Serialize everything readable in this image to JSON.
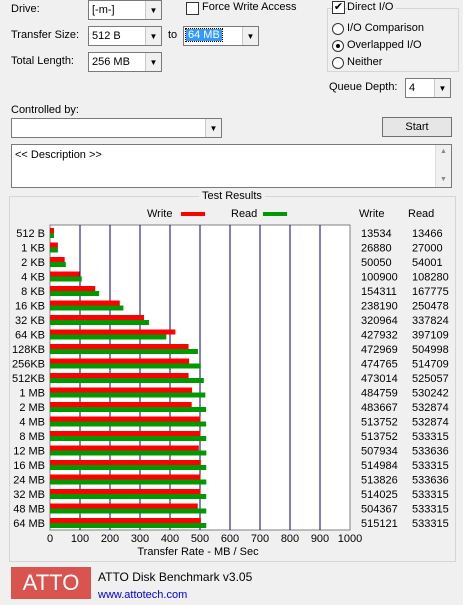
{
  "drive": {
    "label": "Drive:",
    "value": "[-m-]"
  },
  "force_write": {
    "label": "Force Write Access",
    "checked": false
  },
  "direct_io": {
    "label": "Direct I/O",
    "checked": true
  },
  "transfer_size": {
    "label": "Transfer Size:",
    "from": "512 B",
    "to_label": "to",
    "to": "64 MB"
  },
  "total_length": {
    "label": "Total Length:",
    "value": "256 MB"
  },
  "io_mode": {
    "options": [
      "I/O Comparison",
      "Overlapped I/O",
      "Neither"
    ],
    "selected": "Overlapped I/O"
  },
  "queue_depth": {
    "label": "Queue Depth:",
    "value": "4"
  },
  "controlled_by": {
    "label": "Controlled by:",
    "value": ""
  },
  "start_button": "Start",
  "description": "<< Description >>",
  "results": {
    "title": "Test Results",
    "legend_write": "Write",
    "legend_read": "Read",
    "col_write": "Write",
    "col_read": "Read",
    "write_color": "#ff0000",
    "read_color": "#009900",
    "grid_color": "#00008b"
  },
  "chart_data": {
    "type": "bar",
    "orientation": "horizontal",
    "categories": [
      "512 B",
      "1 KB",
      "2 KB",
      "4 KB",
      "8 KB",
      "16 KB",
      "32 KB",
      "64 KB",
      "128KB",
      "256KB",
      "512KB",
      "1 MB",
      "2 MB",
      "4 MB",
      "8 MB",
      "12 MB",
      "16 MB",
      "24 MB",
      "32 MB",
      "48 MB",
      "64 MB"
    ],
    "series": [
      {
        "name": "Write",
        "values": [
          13534,
          26880,
          50050,
          100900,
          154311,
          238190,
          320964,
          427932,
          472969,
          474765,
          473014,
          484759,
          483667,
          513752,
          513752,
          507934,
          514984,
          513826,
          514025,
          504367,
          515121
        ]
      },
      {
        "name": "Read",
        "values": [
          13466,
          27000,
          54001,
          108280,
          167775,
          250478,
          337824,
          397109,
          504998,
          514709,
          525057,
          530242,
          532874,
          532874,
          533315,
          533636,
          533315,
          533636,
          533315,
          533315,
          533315
        ]
      }
    ],
    "x_ticks": [
      "0",
      "100",
      "200",
      "300",
      "400",
      "500",
      "600",
      "700",
      "800",
      "900",
      "1000"
    ],
    "xlim": [
      0,
      1000
    ],
    "xlabel": "Transfer Rate - MB / Sec",
    "grid": true,
    "legend": "top"
  },
  "footer": {
    "logo_text": "ATTO",
    "logo_bg": "#d9534f",
    "app_name": "ATTO Disk Benchmark v3.05",
    "url": "www.attotech.com"
  }
}
